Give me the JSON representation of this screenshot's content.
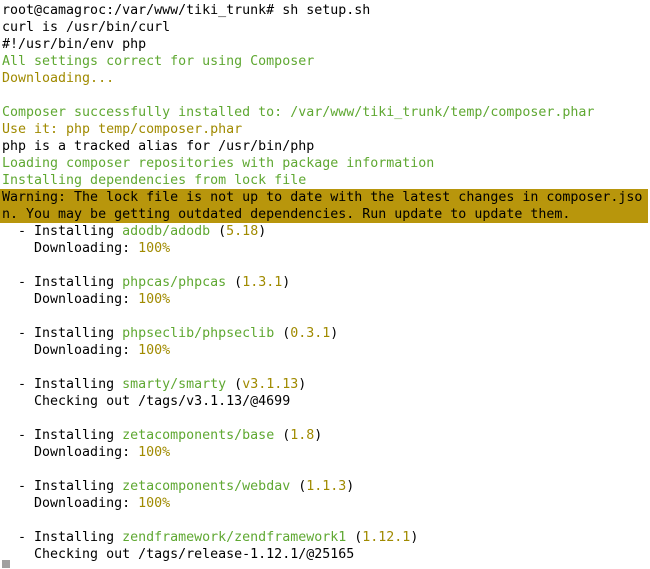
{
  "terminal": {
    "title": "root@camagroc: /var/www/tiki_trunk",
    "colors": {
      "background": "#ffffff",
      "foreground": "#000000",
      "green": "#5fa832",
      "yellow": "#a08a00",
      "warning_background": "#b8960c",
      "cursor": "#a0a0a0"
    },
    "prompt": {
      "user": "root",
      "host": "camagroc",
      "cwd": "/var/www/tiki_trunk",
      "symbol": "#",
      "command": "sh setup.sh",
      "full": "root@camagroc:/var/www/tiki_trunk# sh setup.sh"
    },
    "lines": [
      {
        "segments": [
          {
            "text": "root@camagroc:/var/www/tiki_trunk# sh setup.sh",
            "color": "default"
          }
        ]
      },
      {
        "segments": [
          {
            "text": "curl is /usr/bin/curl",
            "color": "default"
          }
        ]
      },
      {
        "segments": [
          {
            "text": "#!/usr/bin/env php",
            "color": "default"
          }
        ]
      },
      {
        "segments": [
          {
            "text": "All settings correct for using Composer",
            "color": "green"
          }
        ]
      },
      {
        "segments": [
          {
            "text": "Downloading...",
            "color": "yellow"
          }
        ]
      },
      {
        "segments": [
          {
            "text": "",
            "color": "default"
          }
        ]
      },
      {
        "segments": [
          {
            "text": "Composer successfully installed to: /var/www/tiki_trunk/temp/composer.phar",
            "color": "green"
          }
        ]
      },
      {
        "segments": [
          {
            "text": "Use it: php temp/composer.phar",
            "color": "yellow"
          }
        ]
      },
      {
        "segments": [
          {
            "text": "php is a tracked alias for /usr/bin/php",
            "color": "default"
          }
        ]
      },
      {
        "segments": [
          {
            "text": "Loading composer repositories with package information",
            "color": "green"
          }
        ]
      },
      {
        "segments": [
          {
            "text": "Installing dependencies from lock file",
            "color": "green"
          }
        ]
      },
      {
        "warning": true,
        "segments": [
          {
            "text": "Warning: The lock file is not up to date with the latest changes in composer.jso",
            "color": "default"
          }
        ]
      },
      {
        "warning": true,
        "segments": [
          {
            "text": "n. You may be getting outdated dependencies. Run update to update them.",
            "color": "default"
          }
        ]
      },
      {
        "segments": [
          {
            "text": "  - Installing ",
            "color": "default"
          },
          {
            "text": "adodb/adodb",
            "color": "green"
          },
          {
            "text": " (",
            "color": "default"
          },
          {
            "text": "5.18",
            "color": "yellow"
          },
          {
            "text": ")",
            "color": "default"
          }
        ]
      },
      {
        "segments": [
          {
            "text": "    Downloading: ",
            "color": "default"
          },
          {
            "text": "100%",
            "color": "yellow"
          }
        ]
      },
      {
        "segments": [
          {
            "text": "",
            "color": "default"
          }
        ]
      },
      {
        "segments": [
          {
            "text": "  - Installing ",
            "color": "default"
          },
          {
            "text": "phpcas/phpcas",
            "color": "green"
          },
          {
            "text": " (",
            "color": "default"
          },
          {
            "text": "1.3.1",
            "color": "yellow"
          },
          {
            "text": ")",
            "color": "default"
          }
        ]
      },
      {
        "segments": [
          {
            "text": "    Downloading: ",
            "color": "default"
          },
          {
            "text": "100%",
            "color": "yellow"
          }
        ]
      },
      {
        "segments": [
          {
            "text": "",
            "color": "default"
          }
        ]
      },
      {
        "segments": [
          {
            "text": "  - Installing ",
            "color": "default"
          },
          {
            "text": "phpseclib/phpseclib",
            "color": "green"
          },
          {
            "text": " (",
            "color": "default"
          },
          {
            "text": "0.3.1",
            "color": "yellow"
          },
          {
            "text": ")",
            "color": "default"
          }
        ]
      },
      {
        "segments": [
          {
            "text": "    Downloading: ",
            "color": "default"
          },
          {
            "text": "100%",
            "color": "yellow"
          }
        ]
      },
      {
        "segments": [
          {
            "text": "",
            "color": "default"
          }
        ]
      },
      {
        "segments": [
          {
            "text": "  - Installing ",
            "color": "default"
          },
          {
            "text": "smarty/smarty",
            "color": "green"
          },
          {
            "text": " (",
            "color": "default"
          },
          {
            "text": "v3.1.13",
            "color": "yellow"
          },
          {
            "text": ")",
            "color": "default"
          }
        ]
      },
      {
        "segments": [
          {
            "text": "    Checking out /tags/v3.1.13/@4699",
            "color": "default"
          }
        ]
      },
      {
        "segments": [
          {
            "text": "",
            "color": "default"
          }
        ]
      },
      {
        "segments": [
          {
            "text": "  - Installing ",
            "color": "default"
          },
          {
            "text": "zetacomponents/base",
            "color": "green"
          },
          {
            "text": " (",
            "color": "default"
          },
          {
            "text": "1.8",
            "color": "yellow"
          },
          {
            "text": ")",
            "color": "default"
          }
        ]
      },
      {
        "segments": [
          {
            "text": "    Downloading: ",
            "color": "default"
          },
          {
            "text": "100%",
            "color": "yellow"
          }
        ]
      },
      {
        "segments": [
          {
            "text": "",
            "color": "default"
          }
        ]
      },
      {
        "segments": [
          {
            "text": "  - Installing ",
            "color": "default"
          },
          {
            "text": "zetacomponents/webdav",
            "color": "green"
          },
          {
            "text": " (",
            "color": "default"
          },
          {
            "text": "1.1.3",
            "color": "yellow"
          },
          {
            "text": ")",
            "color": "default"
          }
        ]
      },
      {
        "segments": [
          {
            "text": "    Downloading: ",
            "color": "default"
          },
          {
            "text": "100%",
            "color": "yellow"
          }
        ]
      },
      {
        "segments": [
          {
            "text": "",
            "color": "default"
          }
        ]
      },
      {
        "segments": [
          {
            "text": "  - Installing ",
            "color": "default"
          },
          {
            "text": "zendframework/zendframework1",
            "color": "green"
          },
          {
            "text": " (",
            "color": "default"
          },
          {
            "text": "1.12.1",
            "color": "yellow"
          },
          {
            "text": ")",
            "color": "default"
          }
        ]
      },
      {
        "segments": [
          {
            "text": "    Checking out /tags/release-1.12.1/@25165",
            "color": "default"
          }
        ]
      }
    ],
    "packages": [
      {
        "name": "adodb/adodb",
        "version": "5.18",
        "status": "Downloading: 100%"
      },
      {
        "name": "phpcas/phpcas",
        "version": "1.3.1",
        "status": "Downloading: 100%"
      },
      {
        "name": "phpseclib/phpseclib",
        "version": "0.3.1",
        "status": "Downloading: 100%"
      },
      {
        "name": "smarty/smarty",
        "version": "v3.1.13",
        "status": "Checking out /tags/v3.1.13/@4699"
      },
      {
        "name": "zetacomponents/base",
        "version": "1.8",
        "status": "Downloading: 100%"
      },
      {
        "name": "zetacomponents/webdav",
        "version": "1.1.3",
        "status": "Downloading: 100%"
      },
      {
        "name": "zendframework/zendframework1",
        "version": "1.12.1",
        "status": "Checking out /tags/release-1.12.1/@25165"
      }
    ],
    "warning_text": "Warning: The lock file is not up to date with the latest changes in composer.json. You may be getting outdated dependencies. Run update to update them."
  }
}
